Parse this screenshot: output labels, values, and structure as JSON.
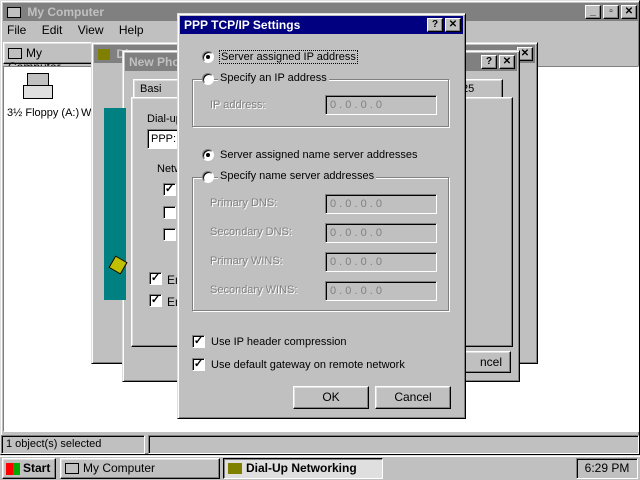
{
  "mycomputer": {
    "title": "My Computer",
    "menu": [
      "File",
      "Edit",
      "View",
      "Help"
    ],
    "address_tab": "My Computer",
    "floppy_label": "3½ Floppy (A:)",
    "partial_label": "W",
    "status": "1 object(s) selected"
  },
  "dialup_window": {
    "title": "Di"
  },
  "newphone": {
    "title": "New Pho",
    "tab1": "Basi",
    "tab2": "25",
    "dialup_label": "Dial-up",
    "ppp_value": "PPP:",
    "network_label": "Netw",
    "en1": "En",
    "en2": "En",
    "cancel_partial": "ncel"
  },
  "dialog": {
    "title": "PPP TCP/IP Settings",
    "help_btn": "?",
    "close_btn": "✕",
    "ip_server_assigned": "Server assigned IP address",
    "ip_specify": "Specify an IP address",
    "ip_address_label": "IP address:",
    "ip_value": "0 . 0 . 0 . 0",
    "ns_server_assigned": "Server assigned name server addresses",
    "ns_specify": "Specify name server addresses",
    "primary_dns": "Primary DNS:",
    "secondary_dns": "Secondary DNS:",
    "primary_wins": "Primary WINS:",
    "secondary_wins": "Secondary WINS:",
    "header_compression": "Use IP header compression",
    "default_gateway": "Use default gateway on remote network",
    "ok": "OK",
    "cancel": "Cancel"
  },
  "taskbar": {
    "start": "Start",
    "task1": "My Computer",
    "task2": "Dial-Up Networking",
    "clock": "6:29 PM"
  },
  "colors": {
    "desktop": "#008080",
    "title_active": "#000080",
    "title_inactive": "#808080",
    "face": "#c0c0c0"
  }
}
